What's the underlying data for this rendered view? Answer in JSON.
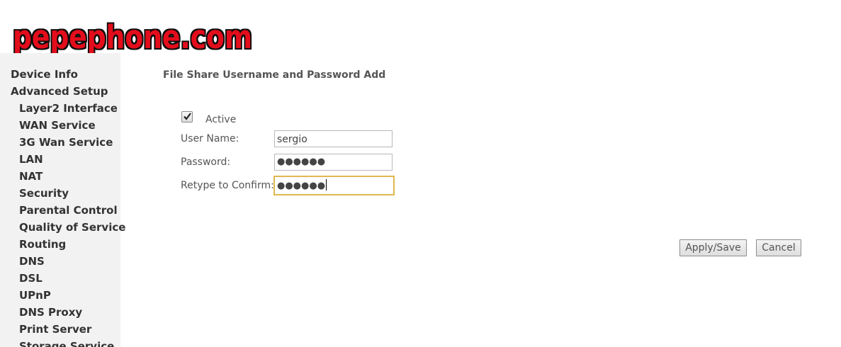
{
  "logo": {
    "text": "pepephone.com",
    "color": "#e4111b"
  },
  "sidebar": {
    "items": [
      {
        "label": "Device Info",
        "level": "top"
      },
      {
        "label": "Advanced Setup",
        "level": "top"
      },
      {
        "label": "Layer2 Interface",
        "level": "sub"
      },
      {
        "label": "WAN Service",
        "level": "sub"
      },
      {
        "label": "3G Wan Service",
        "level": "sub"
      },
      {
        "label": "LAN",
        "level": "sub"
      },
      {
        "label": "NAT",
        "level": "sub"
      },
      {
        "label": "Security",
        "level": "sub"
      },
      {
        "label": "Parental Control",
        "level": "sub"
      },
      {
        "label": "Quality of Service",
        "level": "sub"
      },
      {
        "label": "Routing",
        "level": "sub"
      },
      {
        "label": "DNS",
        "level": "sub"
      },
      {
        "label": "DSL",
        "level": "sub"
      },
      {
        "label": "UPnP",
        "level": "sub"
      },
      {
        "label": "DNS Proxy",
        "level": "sub"
      },
      {
        "label": "Print Server",
        "level": "sub"
      },
      {
        "label": "Storage Service",
        "level": "sub"
      }
    ]
  },
  "main": {
    "title": "File Share Username and Password Add",
    "active": {
      "label": "Active",
      "checked": true
    },
    "fields": {
      "username": {
        "label": "User Name:",
        "value": "sergio"
      },
      "password": {
        "label": "Password:",
        "value": "●●●●●●"
      },
      "confirm": {
        "label": "Retype to Confirm:",
        "value": "●●●●●●"
      }
    },
    "buttons": {
      "apply": "Apply/Save",
      "cancel": "Cancel"
    }
  }
}
